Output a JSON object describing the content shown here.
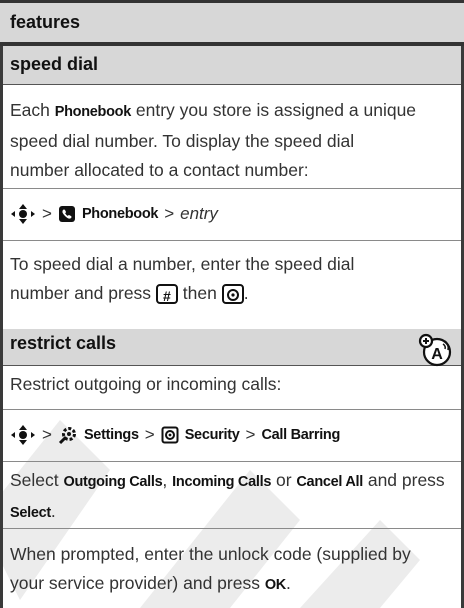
{
  "header": {
    "title": "features"
  },
  "sections": {
    "speed_dial": {
      "title": "speed dial"
    },
    "restrict_calls": {
      "title": "restrict calls"
    }
  },
  "speed_dial": {
    "p1": {
      "pre": "Each ",
      "key": "Phonebook",
      "line1_post": " entry you store is assigned a unique",
      "line2": "speed dial number. To display the speed dial",
      "line3": "number allocated to a contact number:"
    },
    "path": {
      "sep": ">",
      "phonebook": "Phonebook",
      "entry": "entry"
    },
    "p2": {
      "line1": "To speed dial a number, enter the speed dial",
      "line2_pre": "number and press ",
      "key1": "#",
      "mid": " then ",
      "end": "."
    }
  },
  "restrict_calls": {
    "intro": "Restrict outgoing or incoming calls:",
    "path": {
      "sep": ">",
      "settings": "Settings",
      "security": "Security",
      "call_barring": "Call Barring"
    },
    "select": {
      "pre": "Select ",
      "outgoing": "Outgoing Calls",
      "comma": ", ",
      "incoming": "Incoming Calls",
      "or": " or ",
      "cancel": "Cancel All",
      "and": " and press",
      "select_key": "Select",
      "end": "."
    },
    "prompt": {
      "line1": "When prompted, enter the unlock code (supplied by",
      "line2_pre": "your service provider) and press ",
      "ok": "OK",
      "end": "."
    }
  },
  "watermark": {
    "text": "DRAFT",
    "color": "#ebebeb"
  }
}
